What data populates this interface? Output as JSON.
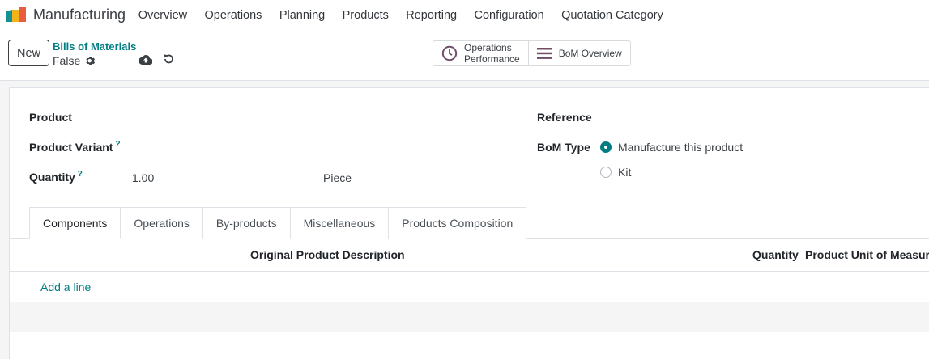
{
  "app": {
    "name": "Manufacturing",
    "menu": [
      "Overview",
      "Operations",
      "Planning",
      "Products",
      "Reporting",
      "Configuration",
      "Quotation Category"
    ]
  },
  "control": {
    "new_label": "New",
    "breadcrumb": "Bills of Materials",
    "record_name": "False",
    "smart_buttons": {
      "operations_line1": "Operations",
      "operations_line2": "Performance",
      "bom_overview": "BoM Overview"
    }
  },
  "form": {
    "product_label": "Product",
    "variant_label": "Product Variant",
    "quantity_label": "Quantity",
    "help_mark": "?",
    "quantity_value": "1.00",
    "uom_value": "Piece",
    "reference_label": "Reference",
    "bom_type_label": "BoM Type",
    "bom_type_options": [
      "Manufacture this product",
      "Kit"
    ],
    "bom_type_selected": "Manufacture this product"
  },
  "tabs": [
    "Components",
    "Operations",
    "By-products",
    "Miscellaneous",
    "Products Composition"
  ],
  "active_tab": "Components",
  "table": {
    "headers": [
      "Original Product Description",
      "Quantity",
      "Product Unit of Measure"
    ],
    "add_line": "Add a line"
  },
  "colors": {
    "accent": "#017e84",
    "text": "#212529"
  }
}
